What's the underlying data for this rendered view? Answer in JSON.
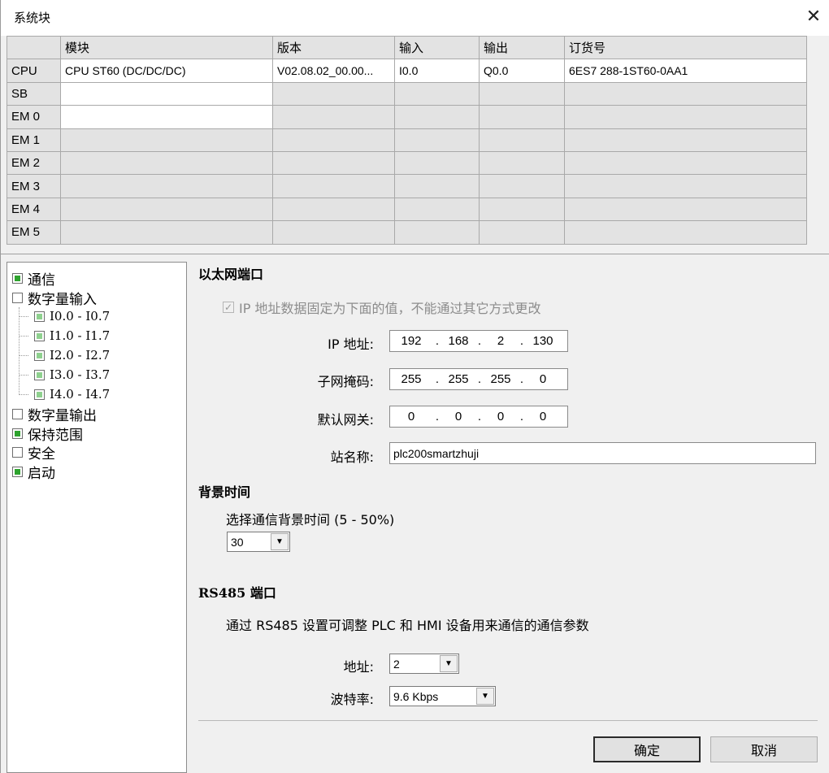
{
  "window": {
    "title": "系统块",
    "close_glyph": "✕"
  },
  "grid": {
    "headers": [
      "",
      "模块",
      "版本",
      "输入",
      "输出",
      "订货号"
    ],
    "rows": [
      {
        "label": "CPU",
        "module": "CPU ST60 (DC/DC/DC)",
        "version": "V02.08.02_00.00...",
        "input": "I0.0",
        "output": "Q0.0",
        "order": "6ES7 288-1ST60-0AA1"
      },
      {
        "label": "SB",
        "module": "",
        "version": "",
        "input": "",
        "output": "",
        "order": ""
      },
      {
        "label": "EM 0",
        "module": "",
        "version": "",
        "input": "",
        "output": "",
        "order": ""
      },
      {
        "label": "EM 1",
        "module": "",
        "version": "",
        "input": "",
        "output": "",
        "order": ""
      },
      {
        "label": "EM 2",
        "module": "",
        "version": "",
        "input": "",
        "output": "",
        "order": ""
      },
      {
        "label": "EM 3",
        "module": "",
        "version": "",
        "input": "",
        "output": "",
        "order": ""
      },
      {
        "label": "EM 4",
        "module": "",
        "version": "",
        "input": "",
        "output": "",
        "order": ""
      },
      {
        "label": "EM 5",
        "module": "",
        "version": "",
        "input": "",
        "output": "",
        "order": ""
      }
    ]
  },
  "tree": {
    "items": [
      {
        "label": "通信",
        "state": "checked"
      },
      {
        "label": "数字量输入",
        "state": "unchecked"
      },
      {
        "label": "I0.0 - I0.7",
        "state": "partial"
      },
      {
        "label": "I1.0 - I1.7",
        "state": "partial"
      },
      {
        "label": "I2.0 - I2.7",
        "state": "partial"
      },
      {
        "label": "I3.0 - I3.7",
        "state": "partial"
      },
      {
        "label": "I4.0 - I4.7",
        "state": "partial"
      },
      {
        "label": "数字量输出",
        "state": "unchecked"
      },
      {
        "label": "保持范围",
        "state": "checked"
      },
      {
        "label": "安全",
        "state": "unchecked"
      },
      {
        "label": "启动",
        "state": "checked"
      }
    ]
  },
  "ethernet": {
    "title": "以太网端口",
    "fixed_ip_label": "IP 地址数据固定为下面的值，不能通过其它方式更改",
    "fixed_ip_checked": true,
    "ip_label": "IP 地址:",
    "ip": [
      "192",
      "168",
      "2",
      "130"
    ],
    "subnet_label": "子网掩码:",
    "subnet": [
      "255",
      "255",
      "255",
      "0"
    ],
    "gateway_label": "默认网关:",
    "gateway": [
      "0",
      "0",
      "0",
      "0"
    ],
    "station_label": "站名称:",
    "station_name": "plc200smartzhuji"
  },
  "background": {
    "title": "背景时间",
    "desc": "选择通信背景时间 (5 - 50%)",
    "value": "30"
  },
  "rs485": {
    "title": "RS485 端口",
    "desc": "通过 RS485 设置可调整 PLC 和 HMI 设备用来通信的通信参数",
    "address_label": "地址:",
    "address": "2",
    "baud_label": "波特率:",
    "baud": "9.6 Kbps"
  },
  "buttons": {
    "ok": "确定",
    "cancel": "取消"
  }
}
